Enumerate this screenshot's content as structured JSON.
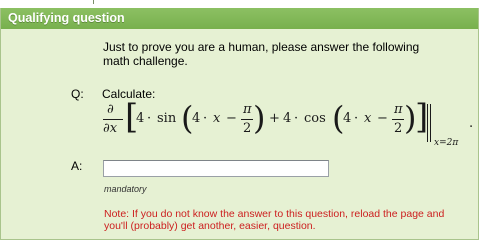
{
  "panel": {
    "title": "Qualifying question",
    "intro": "Just to prove you are a human, please answer the following math challenge."
  },
  "question": {
    "label": "Q:",
    "text": "Calculate:",
    "math": {
      "partial": "∂",
      "wrt": "∂x",
      "coef1": "4",
      "func1": "sin",
      "coef2": "4",
      "var": "x",
      "pi": "π",
      "two": "2",
      "coef3": "4",
      "func2": "cos",
      "coef4": "4",
      "eval_at": "x=2π"
    }
  },
  "answer": {
    "label": "A:",
    "value": "",
    "placeholder": "",
    "hint": "mandatory"
  },
  "note": "Note: If you do not know the answer to this question, reload the page and you'll (probably) get another, easier, question.",
  "colors": {
    "header_bg": "#7fb655",
    "panel_bg": "#e6f1d3",
    "note_text": "#cc1f1f"
  }
}
